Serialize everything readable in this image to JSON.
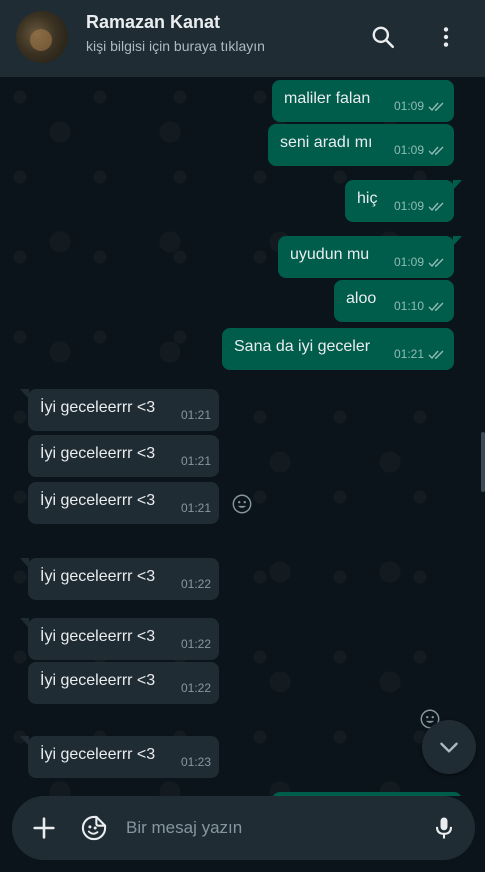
{
  "header": {
    "name": "Ramazan Kanat",
    "subtitle": "kişi bilgisi için buraya tıklayın"
  },
  "messages": [
    {
      "dir": "out",
      "text": "maliler falan",
      "time": "01:09"
    },
    {
      "dir": "out",
      "text": "seni aradı mı",
      "time": "01:09"
    },
    {
      "dir": "out",
      "text": "hiç",
      "time": "01:09"
    },
    {
      "dir": "out",
      "text": "uyudun mu",
      "time": "01:09"
    },
    {
      "dir": "out",
      "text": "aloo",
      "time": "01:10"
    },
    {
      "dir": "out",
      "text": "Sana da iyi geceler",
      "time": "01:21"
    },
    {
      "dir": "in",
      "text": "İyi geceleerrr <3",
      "time": "01:21"
    },
    {
      "dir": "in",
      "text": "İyi geceleerrr <3",
      "time": "01:21"
    },
    {
      "dir": "in",
      "text": "İyi geceleerrr <3",
      "time": "01:21"
    },
    {
      "dir": "in",
      "text": "İyi geceleerrr <3",
      "time": "01:22"
    },
    {
      "dir": "in",
      "text": "İyi geceleerrr <3",
      "time": "01:22"
    },
    {
      "dir": "in",
      "text": "İyi geceleerrr <3",
      "time": "01:22"
    },
    {
      "dir": "in",
      "text": "İyi geceleerrr <3",
      "time": "01:23"
    }
  ],
  "composer": {
    "placeholder": "Bir mesaj yazın"
  },
  "icons": {
    "search": "search-icon",
    "menu": "more-vertical-icon",
    "attach": "plus-icon",
    "sticker": "sticker-icon",
    "mic": "microphone-icon",
    "react": "emoji-icon",
    "scroll": "chevron-down-icon"
  },
  "colors": {
    "outgoing": "#005c4b",
    "incoming": "#202c33",
    "background": "#0b141a"
  }
}
